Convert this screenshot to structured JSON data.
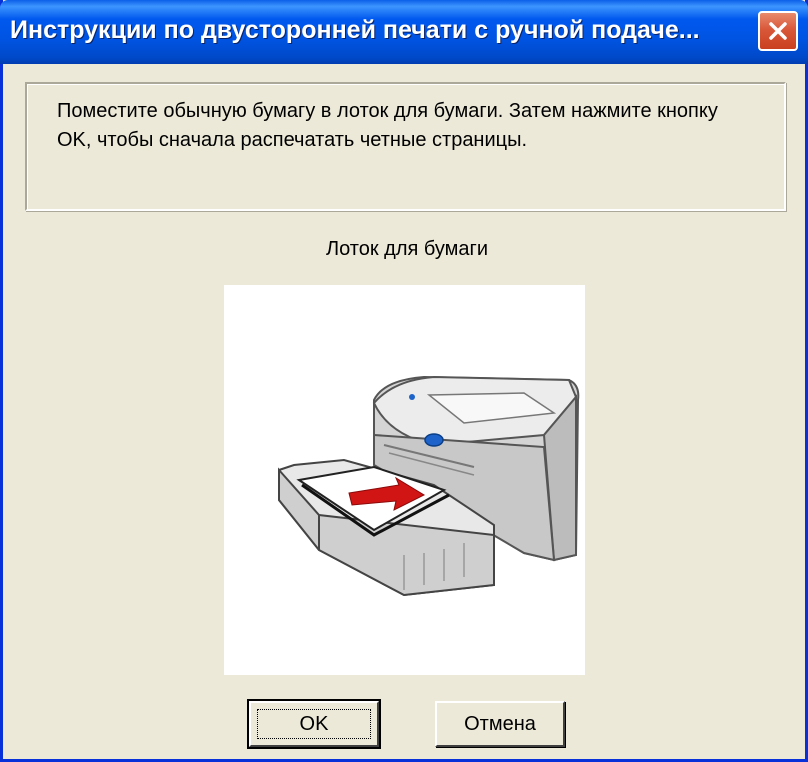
{
  "window": {
    "title": "Инструкции по двусторонней печати с ручной подаче..."
  },
  "message": {
    "text": "Поместите обычную бумагу в лоток для бумаги. Затем нажмите кнопку OK, чтобы сначала распечатать четные страницы."
  },
  "illustration": {
    "caption": "Лоток для бумаги",
    "icon": "printer-paper-tray-illustration"
  },
  "buttons": {
    "ok_label": "OK",
    "cancel_label": "Отмена"
  },
  "colors": {
    "titlebar": "#0054e3",
    "close_button": "#d9583a",
    "dialog_background": "#ece9d8"
  }
}
